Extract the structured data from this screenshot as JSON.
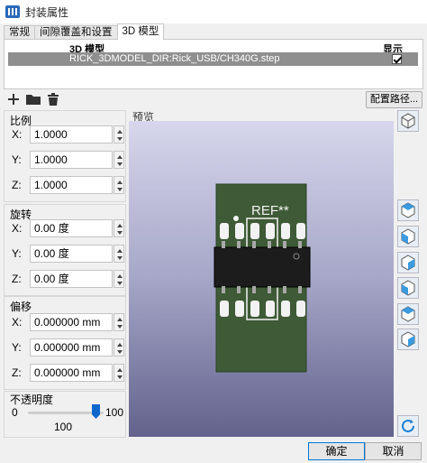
{
  "window": {
    "title": "封装属性"
  },
  "tabs": [
    {
      "label": "常规",
      "active": false
    },
    {
      "label": "间隙覆盖和设置",
      "active": false
    },
    {
      "label": "3D 模型",
      "active": true
    }
  ],
  "models_table": {
    "headers": {
      "model": "3D 模型",
      "show": "显示"
    },
    "rows": [
      {
        "path": "RICK_3DMODEL_DIR:Rick_USB/CH340G.step",
        "show": true
      }
    ]
  },
  "toolbar": {
    "icons": [
      "plus-icon",
      "folder-icon",
      "trash-icon"
    ],
    "config_paths_label": "配置路径..."
  },
  "scale": {
    "title": "比例",
    "x": {
      "label": "X:",
      "value": "1.0000"
    },
    "y": {
      "label": "Y:",
      "value": "1.0000"
    },
    "z": {
      "label": "Z:",
      "value": "1.0000"
    }
  },
  "rotation": {
    "title": "旋转",
    "x": {
      "label": "X:",
      "value": "0.00 度"
    },
    "y": {
      "label": "Y:",
      "value": "0.00 度"
    },
    "z": {
      "label": "Z:",
      "value": "0.00 度"
    }
  },
  "offset": {
    "title": "偏移",
    "x": {
      "label": "X:",
      "value": "0.000000 mm"
    },
    "y": {
      "label": "Y:",
      "value": "0.000000 mm"
    },
    "z": {
      "label": "Z:",
      "value": "0.000000 mm"
    }
  },
  "opacity": {
    "title": "不透明度",
    "min": "0",
    "max": "100",
    "value": "100",
    "level": 1.0
  },
  "preview": {
    "label": "预览",
    "ref_text": "REF**",
    "board_color": "#3e5a36",
    "pad_color": "#f2f2f2",
    "chip_color": "#1c1c1c"
  },
  "view_buttons": [
    "view-iso-icon",
    "view-top-icon",
    "view-bottom-icon",
    "view-left-icon",
    "view-right-icon",
    "view-front-icon",
    "view-back-icon",
    "reload-icon"
  ],
  "dialog_buttons": {
    "ok": "确定",
    "cancel": "取消"
  }
}
